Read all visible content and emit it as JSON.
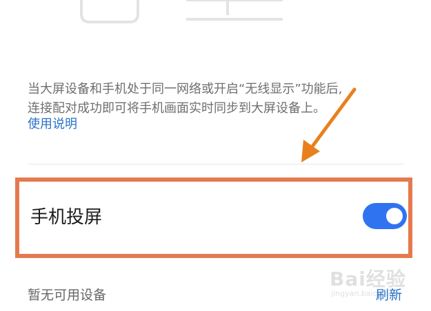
{
  "description": {
    "line1": "当大屏设备和手机处于同一网络或开启“无线显示”功能后,",
    "line2": "连接配对成功即可将手机画面实时同步到大屏设备上。"
  },
  "help_link": "使用说明",
  "screencast": {
    "label": "手机投屏",
    "enabled": true
  },
  "devices": {
    "empty_text": "暂无可用设备",
    "refresh_label": "刷新"
  },
  "watermark": {
    "brand": "Bai经验",
    "domain": "jingyan.baidu.com"
  },
  "colors": {
    "accent": "#2f73f0",
    "link": "#2a73c7",
    "highlight_border": "#e57a4e",
    "arrow": "#e8801e"
  },
  "icons": {
    "top_illustration": "devices-illustration",
    "annotation_arrow": "pointer-arrow",
    "watermark_logo": "baidu-paw-logo"
  }
}
